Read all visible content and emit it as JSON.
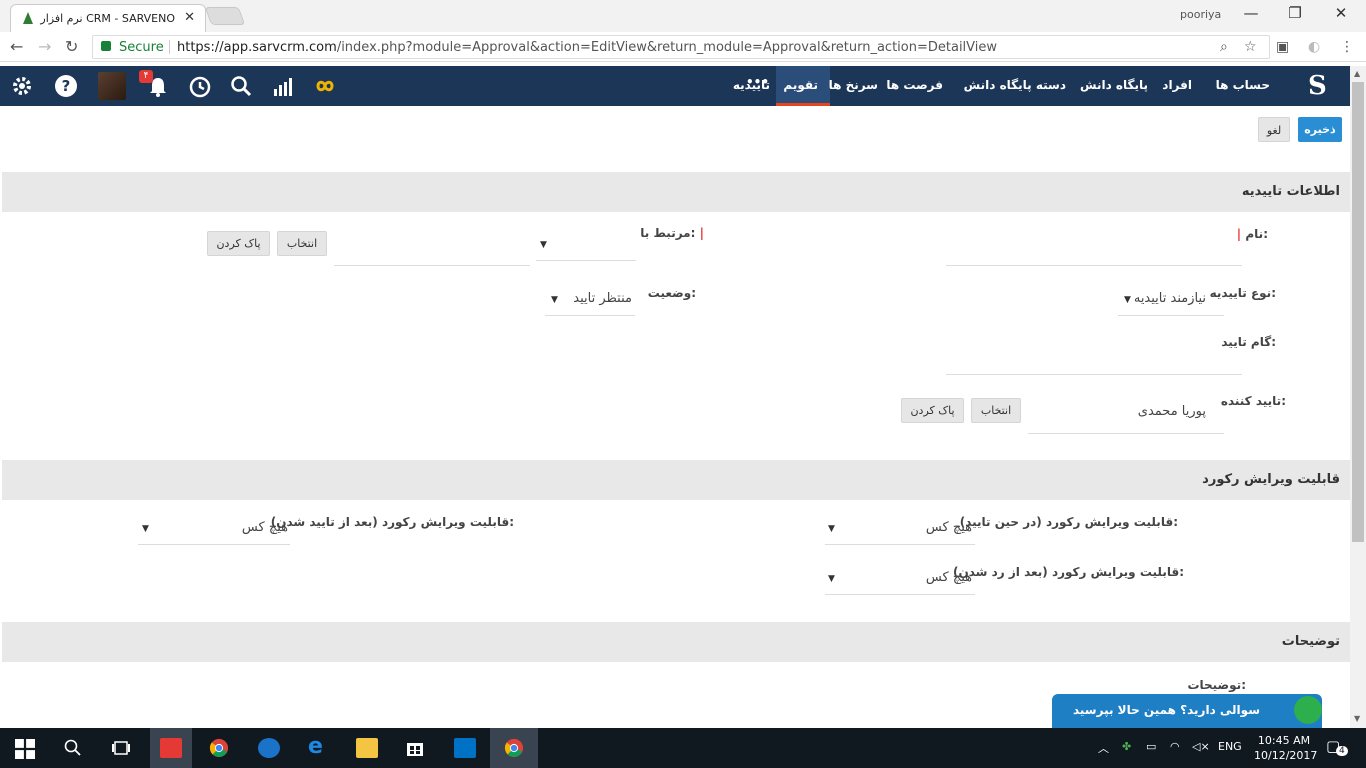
{
  "browser": {
    "tab_title": "نرم افزار CRM - SARVENO",
    "tab_close": "✕",
    "user": "pooriya",
    "secure_label": "Secure",
    "url_host": "https://app.sarvcrm.com",
    "url_path": "/index.php?module=Approval&action=EditView&return_module=Approval&return_action=DetailView"
  },
  "nav": {
    "brand": "S",
    "items": [
      "حساب ها",
      "افراد",
      "پایگاه دانش",
      "دسته پایگاه دانش",
      "فرصت ها",
      "سرنخ ها",
      "تقویم",
      "تاییدیه"
    ],
    "more": "•••",
    "notif_count": "۴",
    "icons": [
      "gear-icon",
      "help-icon",
      "avatar",
      "bell-icon",
      "history-icon",
      "search-icon",
      "chart-icon",
      "infinity-icon"
    ]
  },
  "actions": {
    "save": "ذخیره",
    "cancel": "لغو"
  },
  "section1": {
    "title": "اطلاعات تاییدیه",
    "name_label": "نام:",
    "related_label": "مرتبط با:",
    "select_btn": "انتخاب",
    "clear_btn": "پاک کردن",
    "type_label": "نوع تاییدیه:",
    "type_value": "نیازمند تاییدیه",
    "status_label": "وضعیت:",
    "status_value": "منتظر تایید",
    "step_label": "گام تایید:",
    "approver_label": "تایید کننده:",
    "approver_value": "پوریا محمدی",
    "approver_select": "انتخاب",
    "approver_clear": "پاک کردن"
  },
  "section2": {
    "title": "قابلیت ویرایش رکورد",
    "during_label": "قابلیت ویرایش رکورد (در حین تایید):",
    "during_value": "هیچ کس",
    "after_approve_label": "قابلیت ویرایش رکورد (بعد از تایید شدن):",
    "after_approve_value": "هیچ کس",
    "after_reject_label": "قابلیت ویرایش رکورد (بعد از رد شدن):",
    "after_reject_value": "هیچ کس"
  },
  "section3": {
    "title": "توضیحات",
    "desc_label": "توضیحات:"
  },
  "chat": {
    "text": "سوالی دارید؟ همین حالا بپرسید"
  },
  "taskbar": {
    "time": "10:45 AM",
    "date": "10/12/2017",
    "lang": "ENG",
    "notif_count": "4"
  },
  "colors": {
    "nav_bg": "#1c3658",
    "accent": "#2a8ed4",
    "active_underline": "#e8451e",
    "required": "#e53935"
  }
}
